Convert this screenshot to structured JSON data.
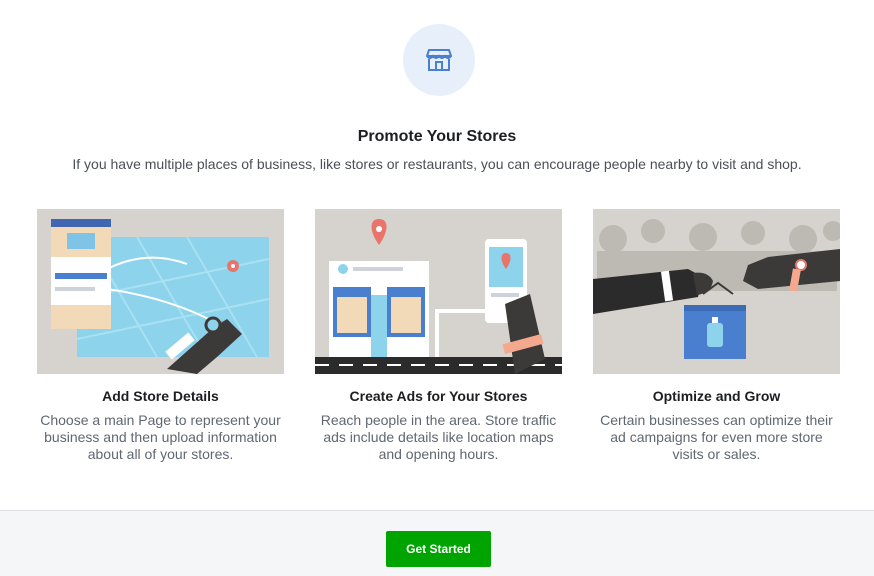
{
  "header": {
    "icon": "storefront-icon",
    "title": "Promote Your Stores",
    "subtitle": "If you have multiple places of business, like stores or restaurants, you can encourage people nearby to visit and shop."
  },
  "cards": [
    {
      "illustration": "map-pins-illustration",
      "title": "Add Store Details",
      "description": "Choose a main Page to represent your business and then upload information about all of your stores."
    },
    {
      "illustration": "storefront-phone-illustration",
      "title": "Create Ads for Your Stores",
      "description": "Reach people in the area. Store traffic ads include details like location maps and opening hours."
    },
    {
      "illustration": "shopping-bag-illustration",
      "title": "Optimize and Grow",
      "description": "Certain businesses can optimize their ad campaigns for even more store visits or sales."
    }
  ],
  "footer": {
    "cta_label": "Get Started"
  },
  "colors": {
    "accent": "#00a400",
    "icon_blue": "#4a7fcf",
    "pin": "#e9756a"
  }
}
